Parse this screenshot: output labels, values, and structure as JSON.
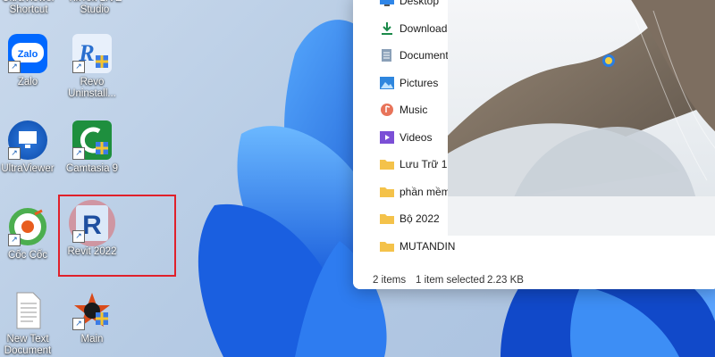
{
  "desktop": {
    "top_labels": [
      "UltraViewer Shortcut",
      "TikTok LIVE Studio"
    ],
    "icons": [
      {
        "label": "Zalo"
      },
      {
        "label": "Revo Uninstall..."
      },
      {
        "label": "UltraViewer"
      },
      {
        "label": "Camtasia 9"
      },
      {
        "label": "Cốc Cốc"
      },
      {
        "label": "Revit 2022"
      },
      {
        "label": "New Text Document"
      },
      {
        "label": "Main"
      }
    ]
  },
  "explorer": {
    "nav": [
      {
        "label": "Desktop",
        "icon": "desktop-icon"
      },
      {
        "label": "Downloads",
        "icon": "download-icon"
      },
      {
        "label": "Documents",
        "icon": "document-icon"
      },
      {
        "label": "Pictures",
        "icon": "pictures-icon"
      },
      {
        "label": "Music",
        "icon": "music-icon"
      },
      {
        "label": "Videos",
        "icon": "videos-icon"
      },
      {
        "label": "Lưu Trữ 1",
        "icon": "folder-icon"
      },
      {
        "label": "phần mềm",
        "icon": "folder-icon"
      },
      {
        "label": "Bộ 2022",
        "icon": "folder-icon"
      },
      {
        "label": "MUTANDIN",
        "icon": "folder-icon"
      }
    ],
    "status": {
      "items": "2 items",
      "selected": "1 item selected",
      "size": "2.23 KB"
    }
  },
  "colors": {
    "highlight": "#e0202a",
    "accent": "#1a73e8"
  }
}
